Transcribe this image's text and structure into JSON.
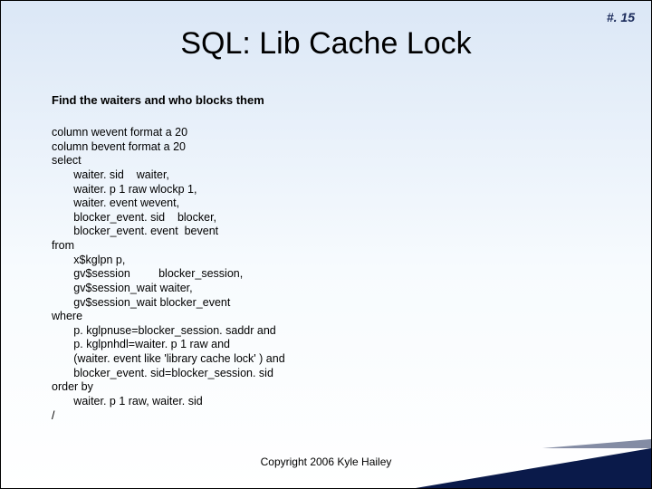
{
  "page_number": "#. 15",
  "title": "SQL: Lib Cache Lock",
  "subtitle": "Find the waiters and who blocks them",
  "code": "column wevent format a 20\ncolumn bevent format a 20\nselect\n       waiter. sid    waiter,\n       waiter. p 1 raw wlockp 1,\n       waiter. event wevent,\n       blocker_event. sid    blocker,\n       blocker_event. event  bevent\nfrom\n       x$kglpn p,\n       gv$session         blocker_session,\n       gv$session_wait waiter,\n       gv$session_wait blocker_event\nwhere\n       p. kglpnuse=blocker_session. saddr and\n       p. kglpnhdl=waiter. p 1 raw and\n       (waiter. event like 'library cache lock' ) and\n       blocker_event. sid=blocker_session. sid\norder by\n       waiter. p 1 raw, waiter. sid\n/",
  "copyright": "Copyright 2006 Kyle Hailey"
}
